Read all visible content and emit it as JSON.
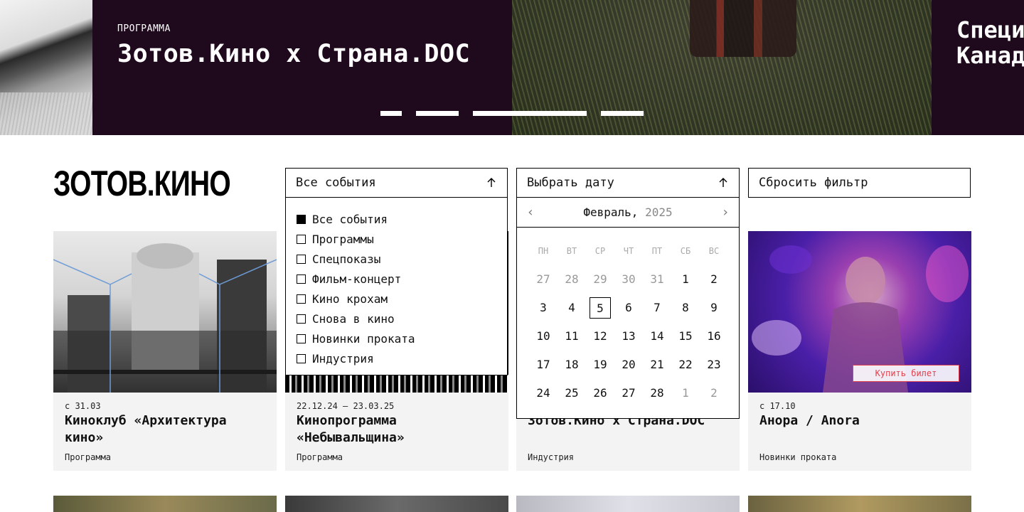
{
  "hero": {
    "kicker": "ПРОГРАММА",
    "title": "Зотов.Кино x Страна.DOC",
    "right_title_line1": "Специ",
    "right_title_line2": "Канад",
    "dots_count": 4
  },
  "logo": "ЗОТОВ.КИНО",
  "filters": {
    "events_label": "Все события",
    "date_label": "Выбрать дату",
    "reset_label": "Сбросить фильтр"
  },
  "events_menu": [
    {
      "label": "Все события",
      "checked": true
    },
    {
      "label": "Программы",
      "checked": false
    },
    {
      "label": "Спецпоказы",
      "checked": false
    },
    {
      "label": "Фильм-концерт",
      "checked": false
    },
    {
      "label": "Кино крохам",
      "checked": false
    },
    {
      "label": "Снова в кино",
      "checked": false
    },
    {
      "label": "Новинки проката",
      "checked": false
    },
    {
      "label": "Индустрия",
      "checked": false
    }
  ],
  "calendar": {
    "month": "Февраль,",
    "year": "2025",
    "weekdays": [
      "ПН",
      "ВТ",
      "СР",
      "ЧТ",
      "ПТ",
      "СБ",
      "ВС"
    ],
    "days": [
      {
        "d": "27",
        "muted": true
      },
      {
        "d": "28",
        "muted": true
      },
      {
        "d": "29",
        "muted": true
      },
      {
        "d": "30",
        "muted": true
      },
      {
        "d": "31",
        "muted": true
      },
      {
        "d": "1"
      },
      {
        "d": "2"
      },
      {
        "d": "3"
      },
      {
        "d": "4"
      },
      {
        "d": "5",
        "today": true
      },
      {
        "d": "6"
      },
      {
        "d": "7"
      },
      {
        "d": "8"
      },
      {
        "d": "9"
      },
      {
        "d": "10"
      },
      {
        "d": "11"
      },
      {
        "d": "12"
      },
      {
        "d": "13"
      },
      {
        "d": "14"
      },
      {
        "d": "15"
      },
      {
        "d": "16"
      },
      {
        "d": "17"
      },
      {
        "d": "18"
      },
      {
        "d": "19"
      },
      {
        "d": "20"
      },
      {
        "d": "21"
      },
      {
        "d": "22"
      },
      {
        "d": "23"
      },
      {
        "d": "24"
      },
      {
        "d": "25"
      },
      {
        "d": "26"
      },
      {
        "d": "27"
      },
      {
        "d": "28"
      },
      {
        "d": "1",
        "muted": true
      },
      {
        "d": "2",
        "muted": true
      }
    ]
  },
  "cards": [
    {
      "date": "с 31.03",
      "title": "Киноклуб «Архитектура кино»",
      "category": "Программа"
    },
    {
      "date": "22.12.24 – 23.03.25",
      "title": "Кинопрограмма «Небывальщина»",
      "category": "Программа"
    },
    {
      "date": "",
      "title": "Зотов.Кино x Страна.DOC",
      "category": "Индустрия"
    },
    {
      "date": "с 17.10",
      "title": "Анора / Anora",
      "category": "Новинки проката",
      "button": "Купить билет"
    }
  ],
  "colors": {
    "hero_bg": "#1f0a1d",
    "ticket_accent": "#e0434d",
    "card_bg": "#f3f3f3"
  }
}
